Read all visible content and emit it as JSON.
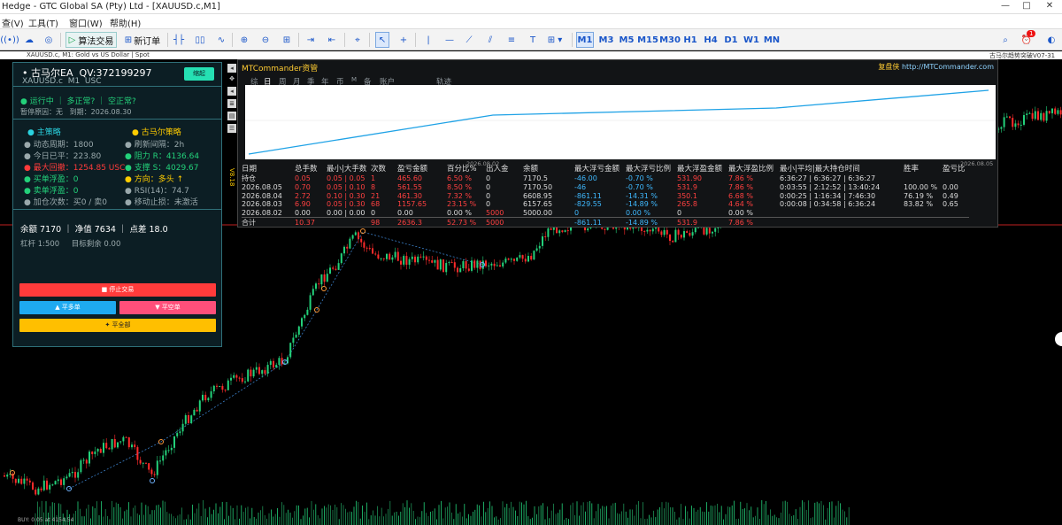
{
  "window": {
    "title": "Hedge - GTC Global SA (Pty) Ltd - [XAUUSD.c,M1]",
    "minimize": "—",
    "maximize": "□",
    "close": "✕"
  },
  "menu": [
    "查(V)",
    "工具(T)",
    "窗口(W)",
    "帮助(H)"
  ],
  "toolbar": {
    "algo_trading": "算法交易",
    "new_order": "新订单",
    "periods": [
      "M1",
      "M3",
      "M5",
      "M15",
      "M30",
      "H1",
      "H4",
      "D1",
      "W1",
      "MN"
    ],
    "active_period": "M1",
    "notification_count": "1"
  },
  "chart_tab": {
    "left": "XAUUSD.c, M1:  Gold vs US Dollar | Spot",
    "right": "古马尔趋势突破V07-31"
  },
  "ea_panel": {
    "name": "古马尔EA",
    "qv": "QV:372199297",
    "symbol": "XAUUSD.c",
    "tf": "M1",
    "currency": "USC",
    "minimize_btn": "缩起",
    "status": "运行中 ｜ 多正常? ｜ 空正常?",
    "pause_reason": "暂停原因：无",
    "expire": "到期：2026.08.30",
    "main_strategy": "主策略",
    "gumar_strategy": "古马尔策略",
    "cycle": "动态周期：1800",
    "refresh": "刷新间隔：2h",
    "today_pnl": "今日已平：223.80",
    "resistance": "阻力 R：4136.64",
    "max_drawdown": "最大回撤：1254.85 USC",
    "support": "支撑 S：4029.67",
    "buy_float": "买单浮盈：0",
    "direction": "方向：多头 ↑",
    "sell_float": "卖单浮盈：0",
    "rsi": "RSI(14)：74.7",
    "add_count": "加仓次数：买0 / 卖0",
    "trailing": "移动止损：未激活",
    "balance_line": "余额 7170 ｜ 净值 7634 ｜ 点差 18.0",
    "leverage": "杠杆 1:500",
    "target": "目标剩余 0.00",
    "stop_btn": "■ 停止交易",
    "close_buy_btn": "▲ 平多单",
    "close_sell_btn": "▼ 平空单",
    "close_all_btn": "✦ 平全部"
  },
  "version_tag": "V8.18",
  "mtc": {
    "title": "MTCommander资管",
    "site_label": "复盘侠",
    "site_url": "http://MTCommander.com",
    "tabs": [
      "综",
      "日",
      "周",
      "月",
      "季",
      "年",
      "币",
      "M",
      "备",
      "账户",
      "轨迹"
    ],
    "graph_dates": [
      "2026.08.02",
      "2026.08.05"
    ],
    "columns": [
      "日期",
      "总手数",
      "最小|大手数",
      "次数",
      "盈亏金额",
      "百分比%",
      "出入金",
      "余额",
      "最大浮亏金额",
      "最大浮亏比例",
      "最大浮盈金额",
      "最大浮盈比例",
      "最小|平均|最大持仓时间",
      "胜率",
      "盈亏比"
    ],
    "rows": [
      [
        "持仓",
        "0.05",
        "0.05 | 0.05",
        "1",
        "465.60",
        "6.50 %",
        "0",
        "7170.5",
        "-46.00",
        "-0.70 %",
        "531.90",
        "7.86 %",
        "6:36:27 | 6:36:27 | 6:36:27",
        "",
        ""
      ],
      [
        "2026.08.05",
        "0.70",
        "0.05 | 0.10",
        "8",
        "561.55",
        "8.50 %",
        "0",
        "7170.50",
        "-46",
        "-0.70 %",
        "531.9",
        "7.86 %",
        "0:03:55 | 2:12:52 | 13:40:24",
        "100.00 %",
        "0.00"
      ],
      [
        "2026.08.04",
        "2.72",
        "0.10 | 0.30",
        "21",
        "461.30",
        "7.32 %",
        "0",
        "6608.95",
        "-861.11",
        "-14.31 %",
        "350.1",
        "6.68 %",
        "0:00:25 | 1:16:34 | 7:46:30",
        "76.19 %",
        "0.49"
      ],
      [
        "2026.08.03",
        "6.90",
        "0.05 | 0.30",
        "68",
        "1157.65",
        "23.15 %",
        "0",
        "6157.65",
        "-829.55",
        "-14.89 %",
        "265.8",
        "4.64 %",
        "0:00:08 | 0:34:58 | 6:36:24",
        "83.82 %",
        "0.65"
      ],
      [
        "2026.08.02",
        "0.00",
        "0.00 | 0.00",
        "0",
        "0.00",
        "0.00 %",
        "5000",
        "5000.00",
        "0",
        "0.00 %",
        "0",
        "0.00 %",
        "",
        "",
        ""
      ],
      [
        "合计",
        "10.37",
        "",
        "98",
        "2636.3",
        "52.73 %",
        "5000",
        "",
        "-861.11",
        "-14.89 %",
        "531.9",
        "7.86 %",
        "",
        "",
        ""
      ]
    ]
  },
  "volume_label": "BUY: 0.05  at 4154.54",
  "colors": {
    "bull": "#23d17a",
    "bear": "#ff2b2b",
    "accent": "#2ad3e0",
    "panel_bg": "#0c1e24",
    "stop": "#ff3b3b",
    "close_buy": "#1eaaf0",
    "close_sell": "#ff4f7a",
    "close_all": "#ffbf00"
  }
}
